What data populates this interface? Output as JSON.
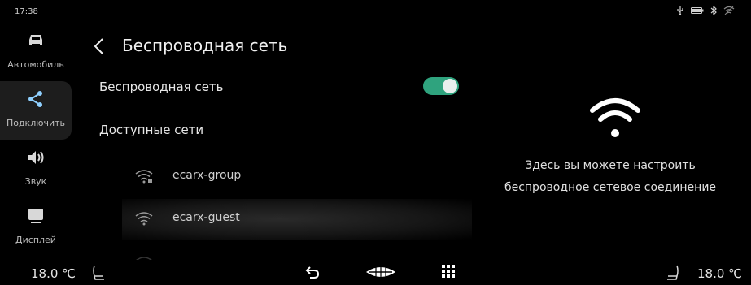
{
  "status_bar": {
    "time": "17:38",
    "icons": [
      "usb-icon",
      "battery-icon",
      "bluetooth-icon",
      "wifi-off-icon"
    ]
  },
  "sidebar": {
    "items": [
      {
        "label": "Автомобиль",
        "icon": "car-icon",
        "active": false
      },
      {
        "label": "Подключить",
        "icon": "share-icon",
        "active": true
      },
      {
        "label": "Звук",
        "icon": "speaker-icon",
        "active": false
      },
      {
        "label": "Дисплей",
        "icon": "display-icon",
        "active": false
      }
    ]
  },
  "panel": {
    "title": "Беспроводная сеть",
    "wifi_toggle_label": "Беспроводная сеть",
    "wifi_enabled": true,
    "available_networks_label": "Доступные сети",
    "networks": [
      {
        "name": "ecarx-group",
        "icon": "wifi-lock-icon"
      },
      {
        "name": "ecarx-guest",
        "icon": "wifi-icon"
      }
    ]
  },
  "info": {
    "icon": "wifi-large-icon",
    "line1": "Здесь вы можете настроить",
    "line2": "беспроводное сетевое соединение"
  },
  "bottom_bar": {
    "left_temp": "18.0 ℃",
    "right_temp": "18.0 ℃",
    "icons": [
      "seat-left-icon",
      "back-icon",
      "car-logo-icon",
      "apps-grid-icon",
      "seat-right-icon"
    ]
  },
  "colors": {
    "background": "#000000",
    "toggle_on": "#2fa37e",
    "active_sidebar": "#1d1d1d"
  }
}
